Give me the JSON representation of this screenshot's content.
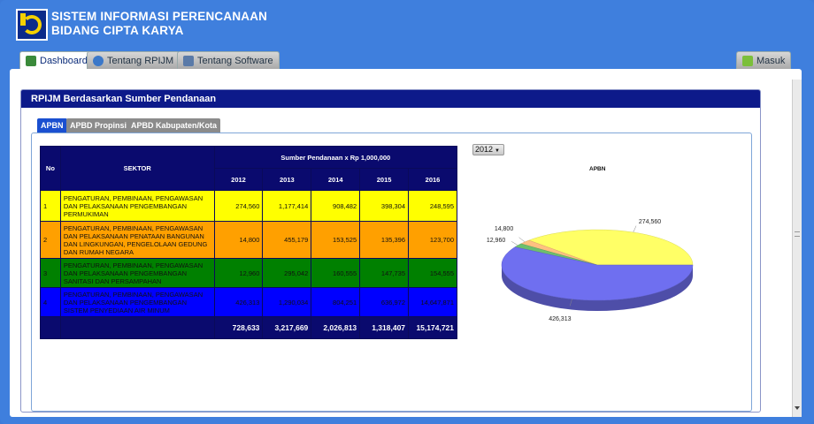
{
  "app": {
    "title_line1": "SISTEM INFORMASI PERENCANAAN",
    "title_line2": "BIDANG CIPTA KARYA"
  },
  "tabs": [
    {
      "label": "Dashboard",
      "icon": "home-icon",
      "active": true
    },
    {
      "label": "Tentang RPIJM",
      "icon": "info-icon",
      "active": false
    },
    {
      "label": "Tentang Software",
      "icon": "software-icon",
      "active": false
    }
  ],
  "login_tab": {
    "label": "Masuk",
    "icon": "login-icon"
  },
  "section": {
    "title": "RPIJM Berdasarkan Sumber Pendanaan"
  },
  "subtabs": [
    {
      "label": "APBN",
      "active": true
    },
    {
      "label": "APBD Propinsi",
      "active": false
    },
    {
      "label": "APBD Kabupaten/Kota",
      "active": false
    }
  ],
  "table": {
    "col_no": "No",
    "col_sektor": "SEKTOR",
    "col_group": "Sumber Pendanaan x Rp 1,000,000",
    "years": [
      "2012",
      "2013",
      "2014",
      "2015",
      "2016"
    ],
    "rows": [
      {
        "no": "1",
        "sektor": "PENGATURAN, PEMBINAAN, PENGAWASAN DAN PELAKSANAAN PENGEMBANGAN PERMUKIMAN",
        "values": [
          "274,560",
          "1,177,414",
          "908,482",
          "398,304",
          "248,595"
        ],
        "color": "#ffff00"
      },
      {
        "no": "2",
        "sektor": "PENGATURAN, PEMBINAAN, PENGAWASAN DAN PELAKSANAAN PENATAAN BANGUNAN DAN LINGKUNGAN, PENGELOLAAN GEDUNG DAN RUMAH NEGARA",
        "values": [
          "14,800",
          "455,179",
          "153,525",
          "135,396",
          "123,700"
        ],
        "color": "#ffa000"
      },
      {
        "no": "3",
        "sektor": "PENGATURAN, PEMBINAAN, PENGAWASAN DAN PELAKSANAAN PENGEMBANGAN SANITASI DAN PERSAMPAHAN",
        "values": [
          "12,960",
          "295,042",
          "160,555",
          "147,735",
          "154,555"
        ],
        "color": "#008000"
      },
      {
        "no": "4",
        "sektor": "PENGATURAN, PEMBINAAN, PENGAWASAN DAN PELAKSANAAN PENGEMBANGAN SISTEM PENYEDIAAN AIR MINUM",
        "values": [
          "426,313",
          "1,290,034",
          "804,251",
          "636,972",
          "14,647,871"
        ],
        "color": "#0000ff"
      }
    ],
    "totals": [
      "728,633",
      "3,217,669",
      "2,026,813",
      "1,318,407",
      "15,174,721"
    ]
  },
  "year_select": {
    "value": "2012"
  },
  "chart_data": {
    "type": "pie",
    "title": "APBN",
    "slices": [
      {
        "label": "274,560",
        "value": 274560,
        "color": "#ffff66"
      },
      {
        "label": "14,800",
        "value": 14800,
        "color": "#ffc080"
      },
      {
        "label": "12,960",
        "value": 12960,
        "color": "#6dbf6d"
      },
      {
        "label": "426,313",
        "value": 426313,
        "color": "#6f6ff0"
      }
    ]
  }
}
